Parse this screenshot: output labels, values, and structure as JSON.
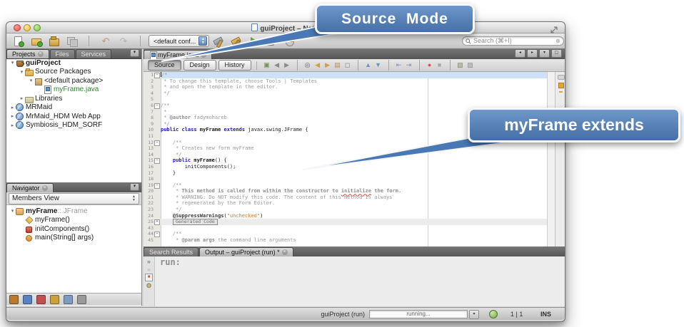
{
  "window": {
    "title": "guiProject – NetB"
  },
  "callouts": {
    "top": "Source  Mode",
    "right": "myFrame extends"
  },
  "toolbar": {
    "config": "<default conf...",
    "search": "Search (⌘+I)",
    "file_icons": [
      {
        "n": "new-file-icon"
      },
      {
        "n": "new-project-icon"
      },
      {
        "n": "open-project-icon"
      },
      {
        "n": "save-all-icon"
      },
      {
        "sep": 1
      },
      {
        "n": "undo-icon",
        "g": "↶",
        "c": "#c49a76"
      },
      {
        "n": "redo-icon",
        "g": "↷",
        "c": "#b5b5b5"
      },
      {
        "sep": 1
      }
    ],
    "build_icons": [
      {
        "n": "build-icon"
      },
      {
        "n": "clean-build-icon"
      },
      {
        "n": "run-icon"
      },
      {
        "n": "debug-icon"
      },
      {
        "n": "profile-icon"
      }
    ]
  },
  "panels": {
    "projects": {
      "tabs": [
        "Projects",
        "Files",
        "Services"
      ],
      "tree": [
        {
          "ind": 0,
          "arr": "v",
          "icon": "project-icon",
          "label": "guiProject",
          "bold": true
        },
        {
          "ind": 1,
          "arr": "v",
          "icon": "folder-icon",
          "label": "Source Packages"
        },
        {
          "ind": 2,
          "arr": "v",
          "icon": "package-icon",
          "label": "<default package>"
        },
        {
          "ind": 3,
          "arr": "",
          "icon": "form-icon",
          "label": "myFrame.java",
          "color": "#2e8b2e"
        },
        {
          "ind": 1,
          "arr": ">",
          "icon": "libraries-icon",
          "label": "Libraries"
        },
        {
          "ind": 0,
          "arr": ">",
          "icon": "web-project-icon",
          "label": "MRMaid"
        },
        {
          "ind": 0,
          "arr": ">",
          "icon": "web-project-icon",
          "label": "MrMaid_HDM Web App"
        },
        {
          "ind": 0,
          "arr": ">",
          "icon": "web-project-icon",
          "label": "Symbiosis_HDM_SORF"
        }
      ]
    },
    "navigator": {
      "tab": "Navigator",
      "view": "Members View",
      "items": [
        {
          "ind": 0,
          "arr": "v",
          "icon": "class-icon",
          "label": "myFrame",
          "suffix": " :: JFrame",
          "bold": true
        },
        {
          "ind": 1,
          "arr": "",
          "icon": "constructor-icon",
          "label": "myFrame()"
        },
        {
          "ind": 1,
          "arr": "",
          "icon": "private-method-icon",
          "label": "initComponents()"
        },
        {
          "ind": 1,
          "arr": "",
          "icon": "static-method-icon",
          "label": "main(String[] args)"
        }
      ],
      "filters": [
        {
          "n": "show-inherited-icon",
          "bg": "#b97a2e"
        },
        {
          "n": "show-fields-icon",
          "bg": "#5a83bd"
        },
        {
          "n": "show-static-icon",
          "bg": "#c25050"
        },
        {
          "n": "show-non-public-icon",
          "bg": "#c9a23c"
        },
        {
          "n": "sort-alpha-icon",
          "bg": "#7f9cc0"
        },
        {
          "n": "sort-source-icon",
          "bg": "#9a9a9a"
        }
      ]
    }
  },
  "editor": {
    "tab": "myFrame.java",
    "views": [
      "Source",
      "Design",
      "History"
    ],
    "toolbar_icons": [
      {
        "n": "last-edit-icon",
        "g": "▣",
        "c": "#6f8f5a"
      },
      {
        "n": "back-icon",
        "g": "◀",
        "c": "#8a8a8a"
      },
      {
        "n": "forward-icon",
        "g": "▶",
        "c": "#8a8a8a"
      },
      {
        "sep": 1
      },
      {
        "n": "find-icon",
        "g": "◎",
        "c": "#56606e"
      },
      {
        "n": "find-previous-icon",
        "g": "◀",
        "c": "#d79b3c"
      },
      {
        "n": "find-next-icon",
        "g": "▶",
        "c": "#d79b3c"
      },
      {
        "n": "highlight-icon",
        "g": "▤",
        "c": "#c7893a"
      },
      {
        "n": "select-in-icon",
        "g": "◻",
        "c": "#7d7d7d"
      },
      {
        "sep": 1
      },
      {
        "n": "previous-occurrence-icon",
        "g": "▲",
        "c": "#6d93c9"
      },
      {
        "n": "next-occurrence-icon",
        "g": "▼",
        "c": "#6d93c9"
      },
      {
        "sep": 1
      },
      {
        "n": "shift-left-icon",
        "g": "⇤",
        "c": "#6d93c9"
      },
      {
        "n": "shift-right-icon",
        "g": "⇥",
        "c": "#6d93c9"
      },
      {
        "sep": 1
      },
      {
        "n": "record-macro-icon",
        "g": "●",
        "c": "#d4564a"
      },
      {
        "n": "stop-macro-icon",
        "g": "■",
        "c": "#a9a9a9"
      },
      {
        "sep": 1
      },
      {
        "n": "comment-icon",
        "g": "▧",
        "c": "#7c8b4e"
      },
      {
        "n": "uncomment-icon",
        "g": "▨",
        "c": "#8b8b8b"
      }
    ],
    "code": [
      {
        "n": "1",
        "fold": "-",
        "sel": true,
        "seg": [
          [
            "/*",
            "cm"
          ]
        ]
      },
      {
        "n": "2",
        "seg": [
          [
            " * To change this template, choose Tools | Templates",
            "cm"
          ]
        ]
      },
      {
        "n": "3",
        "seg": [
          [
            " * and open the template in the editor.",
            "cm"
          ]
        ]
      },
      {
        "n": "4",
        "seg": [
          [
            " */",
            "cm"
          ]
        ]
      },
      {
        "n": "5",
        "seg": []
      },
      {
        "n": "6",
        "fold": "-",
        "seg": [
          [
            "/**",
            "cm"
          ]
        ]
      },
      {
        "n": "7",
        "seg": [
          [
            " *",
            "cm"
          ]
        ]
      },
      {
        "n": "8",
        "seg": [
          [
            " * ",
            "cm"
          ],
          [
            "@author",
            "tag"
          ],
          [
            " fadymohareb",
            "cm"
          ]
        ]
      },
      {
        "n": "9",
        "seg": [
          [
            " */",
            "cm"
          ]
        ]
      },
      {
        "n": "10",
        "seg": [
          [
            "public class ",
            "kw"
          ],
          [
            "myFrame",
            "b"
          ],
          [
            " ",
            "p"
          ],
          [
            "extends",
            "kw"
          ],
          [
            " javax.swing.JFrame {",
            "p"
          ]
        ]
      },
      {
        "n": "11",
        "seg": []
      },
      {
        "n": "12",
        "fold": "-",
        "seg": [
          [
            "    /**",
            "cm"
          ]
        ]
      },
      {
        "n": "13",
        "seg": [
          [
            "     * Creates new form myFrame",
            "cm"
          ]
        ]
      },
      {
        "n": "14",
        "seg": [
          [
            "     */",
            "cm"
          ]
        ]
      },
      {
        "n": "15",
        "fold": "-",
        "seg": [
          [
            "    ",
            "p"
          ],
          [
            "public ",
            "kw"
          ],
          [
            "myFrame",
            "b"
          ],
          [
            "() {",
            "p"
          ]
        ]
      },
      {
        "n": "16",
        "seg": [
          [
            "        initComponents();",
            "p"
          ]
        ]
      },
      {
        "n": "17",
        "seg": [
          [
            "    }",
            "p"
          ]
        ]
      },
      {
        "n": "18",
        "seg": []
      },
      {
        "n": "19",
        "fold": "-",
        "seg": [
          [
            "    /**",
            "cm"
          ]
        ]
      },
      {
        "n": "20",
        "seg": [
          [
            "     * ",
            "cm"
          ],
          [
            "This method is called from within the constructor to ",
            "cmb"
          ],
          [
            "initialize",
            "cmb wv"
          ],
          [
            " the form.",
            "cmb"
          ]
        ]
      },
      {
        "n": "21",
        "seg": [
          [
            "     * WARNING: Do NOT modify this code. The content of this method is always",
            "cm"
          ]
        ]
      },
      {
        "n": "22",
        "seg": [
          [
            "     * regenerated by the Form Editor.",
            "cm"
          ]
        ]
      },
      {
        "n": "23",
        "seg": [
          [
            "     */",
            "cm"
          ]
        ]
      },
      {
        "n": "24",
        "seg": [
          [
            "    ",
            "p"
          ],
          [
            "@SuppressWarnings",
            "an"
          ],
          [
            "(",
            "p"
          ],
          [
            "\"unchecked\"",
            "st"
          ],
          [
            ")",
            "p"
          ]
        ]
      },
      {
        "n": "25",
        "fold": "+",
        "box": "Generated Code",
        "seg": []
      },
      {
        "n": "43",
        "seg": []
      },
      {
        "n": "44",
        "fold": "-",
        "seg": [
          [
            "    /**",
            "cm"
          ]
        ]
      },
      {
        "n": "45",
        "seg": [
          [
            "     * ",
            "cm"
          ],
          [
            "@param",
            "tag"
          ],
          [
            " args",
            "tag"
          ],
          [
            " the command line arguments",
            "cm"
          ]
        ]
      }
    ]
  },
  "output": {
    "tabs": [
      "Search Results",
      "Output – guiProject (run) *"
    ],
    "text": "run:",
    "gutter_icons": [
      {
        "n": "rerun-icon",
        "g": "»",
        "c": "#5f9e46"
      },
      {
        "n": "rerun-stale-icon",
        "g": "»",
        "c": "#b3cba8"
      },
      {
        "n": "stop-run-icon",
        "g": "■",
        "c": "#d0493e",
        "box": 1
      },
      {
        "n": "run-settings-icon",
        "g": "⚙",
        "c": "#8f8a52"
      }
    ]
  },
  "status": {
    "project": "guiProject (run)",
    "progress": "running...",
    "caret": "1 | 1",
    "mode": "INS"
  },
  "editor_tab_controls": [
    "◂",
    "▸",
    "▾",
    "▢"
  ],
  "colors": {
    "callout_blue": "#4a78b5",
    "selection_blue": "#cde2f7",
    "keyword_blue": "#1a1ab8",
    "string_orange": "#cb7832"
  }
}
